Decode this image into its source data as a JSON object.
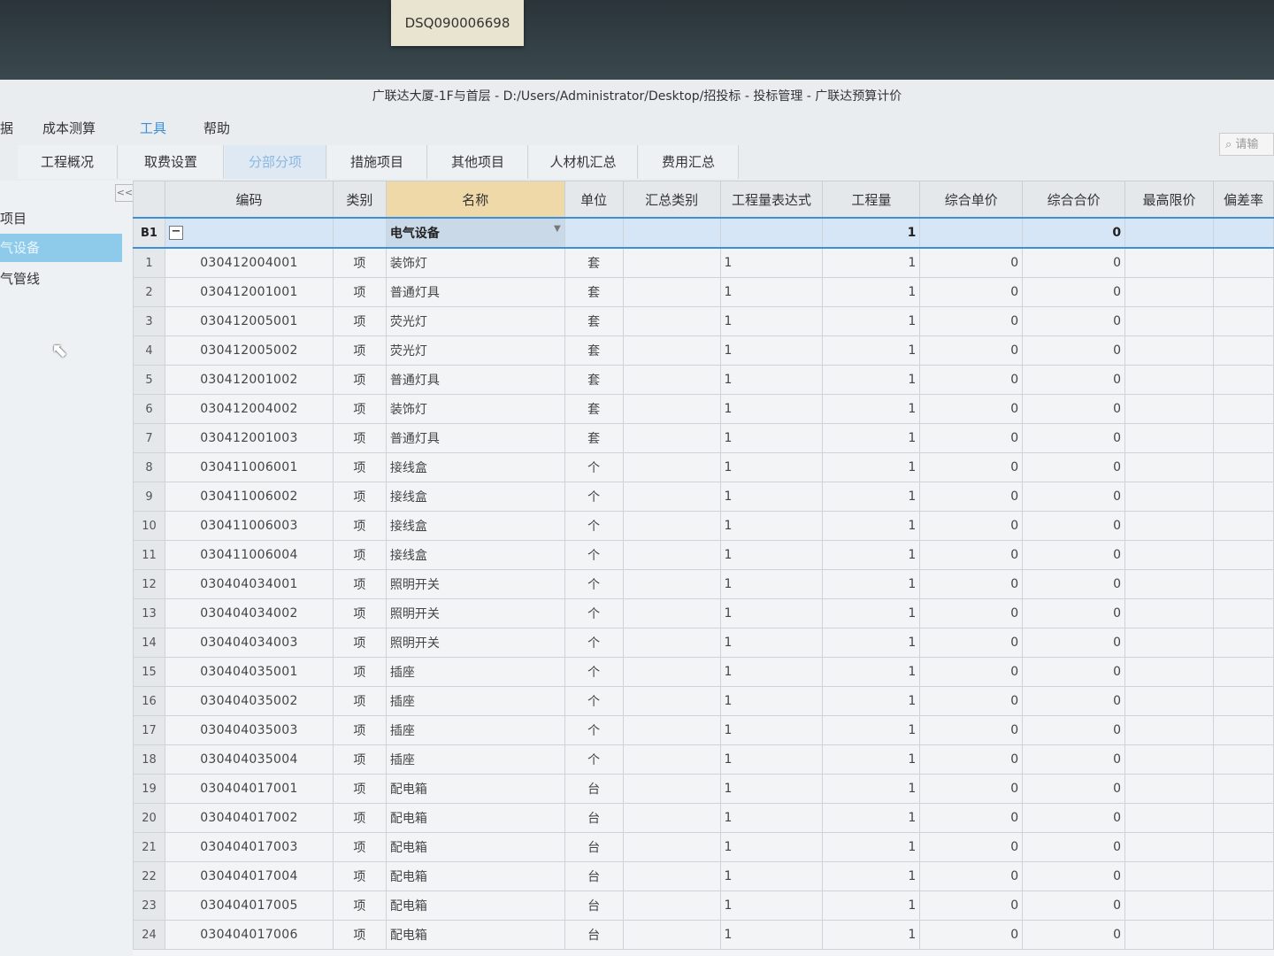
{
  "sticker": {
    "label": "DSQ090006698"
  },
  "window": {
    "title": "广联达大厦-1F与首层 - D:/Users/Administrator/Desktop/招投标 - 投标管理 - 广联达预算计价"
  },
  "menu": {
    "items": [
      {
        "label": "据"
      },
      {
        "label": "成本测算"
      },
      {
        "label": "工具"
      },
      {
        "label": "帮助"
      }
    ],
    "active_index": 2
  },
  "search": {
    "placeholder": "请输"
  },
  "tabs": {
    "items": [
      {
        "label": "工程概况"
      },
      {
        "label": "取费设置"
      },
      {
        "label": "分部分项"
      },
      {
        "label": "措施项目"
      },
      {
        "label": "其他项目"
      },
      {
        "label": "人材机汇总"
      },
      {
        "label": "费用汇总"
      }
    ],
    "active_index": 2
  },
  "sidebar": {
    "collapse_label": "<<",
    "items": [
      {
        "label": "项目"
      },
      {
        "label": "气设备"
      },
      {
        "label": "气管线"
      }
    ]
  },
  "table": {
    "headers": {
      "code": "编码",
      "type": "类别",
      "name": "名称",
      "unit": "单位",
      "summary": "汇总类别",
      "expr": "工程量表达式",
      "qty": "工程量",
      "unit_price": "综合单价",
      "total": "综合合价",
      "max_price": "最高限价",
      "dev": "偏差率"
    },
    "group": {
      "rn": "B1",
      "name": "电气设备",
      "qty": "1",
      "total": "0"
    },
    "rows": [
      {
        "rn": "1",
        "code": "030412004001",
        "type": "项",
        "name": "装饰灯",
        "unit": "套",
        "expr": "1",
        "qty": "1",
        "unit_price": "0",
        "total": "0"
      },
      {
        "rn": "2",
        "code": "030412001001",
        "type": "项",
        "name": "普通灯具",
        "unit": "套",
        "expr": "1",
        "qty": "1",
        "unit_price": "0",
        "total": "0"
      },
      {
        "rn": "3",
        "code": "030412005001",
        "type": "项",
        "name": "荧光灯",
        "unit": "套",
        "expr": "1",
        "qty": "1",
        "unit_price": "0",
        "total": "0"
      },
      {
        "rn": "4",
        "code": "030412005002",
        "type": "项",
        "name": "荧光灯",
        "unit": "套",
        "expr": "1",
        "qty": "1",
        "unit_price": "0",
        "total": "0"
      },
      {
        "rn": "5",
        "code": "030412001002",
        "type": "项",
        "name": "普通灯具",
        "unit": "套",
        "expr": "1",
        "qty": "1",
        "unit_price": "0",
        "total": "0"
      },
      {
        "rn": "6",
        "code": "030412004002",
        "type": "项",
        "name": "装饰灯",
        "unit": "套",
        "expr": "1",
        "qty": "1",
        "unit_price": "0",
        "total": "0"
      },
      {
        "rn": "7",
        "code": "030412001003",
        "type": "项",
        "name": "普通灯具",
        "unit": "套",
        "expr": "1",
        "qty": "1",
        "unit_price": "0",
        "total": "0"
      },
      {
        "rn": "8",
        "code": "030411006001",
        "type": "项",
        "name": "接线盒",
        "unit": "个",
        "expr": "1",
        "qty": "1",
        "unit_price": "0",
        "total": "0"
      },
      {
        "rn": "9",
        "code": "030411006002",
        "type": "项",
        "name": "接线盒",
        "unit": "个",
        "expr": "1",
        "qty": "1",
        "unit_price": "0",
        "total": "0"
      },
      {
        "rn": "10",
        "code": "030411006003",
        "type": "项",
        "name": "接线盒",
        "unit": "个",
        "expr": "1",
        "qty": "1",
        "unit_price": "0",
        "total": "0"
      },
      {
        "rn": "11",
        "code": "030411006004",
        "type": "项",
        "name": "接线盒",
        "unit": "个",
        "expr": "1",
        "qty": "1",
        "unit_price": "0",
        "total": "0"
      },
      {
        "rn": "12",
        "code": "030404034001",
        "type": "项",
        "name": "照明开关",
        "unit": "个",
        "expr": "1",
        "qty": "1",
        "unit_price": "0",
        "total": "0"
      },
      {
        "rn": "13",
        "code": "030404034002",
        "type": "项",
        "name": "照明开关",
        "unit": "个",
        "expr": "1",
        "qty": "1",
        "unit_price": "0",
        "total": "0"
      },
      {
        "rn": "14",
        "code": "030404034003",
        "type": "项",
        "name": "照明开关",
        "unit": "个",
        "expr": "1",
        "qty": "1",
        "unit_price": "0",
        "total": "0"
      },
      {
        "rn": "15",
        "code": "030404035001",
        "type": "项",
        "name": "插座",
        "unit": "个",
        "expr": "1",
        "qty": "1",
        "unit_price": "0",
        "total": "0"
      },
      {
        "rn": "16",
        "code": "030404035002",
        "type": "项",
        "name": "插座",
        "unit": "个",
        "expr": "1",
        "qty": "1",
        "unit_price": "0",
        "total": "0"
      },
      {
        "rn": "17",
        "code": "030404035003",
        "type": "项",
        "name": "插座",
        "unit": "个",
        "expr": "1",
        "qty": "1",
        "unit_price": "0",
        "total": "0"
      },
      {
        "rn": "18",
        "code": "030404035004",
        "type": "项",
        "name": "插座",
        "unit": "个",
        "expr": "1",
        "qty": "1",
        "unit_price": "0",
        "total": "0"
      },
      {
        "rn": "19",
        "code": "030404017001",
        "type": "项",
        "name": "配电箱",
        "unit": "台",
        "expr": "1",
        "qty": "1",
        "unit_price": "0",
        "total": "0"
      },
      {
        "rn": "20",
        "code": "030404017002",
        "type": "项",
        "name": "配电箱",
        "unit": "台",
        "expr": "1",
        "qty": "1",
        "unit_price": "0",
        "total": "0"
      },
      {
        "rn": "21",
        "code": "030404017003",
        "type": "项",
        "name": "配电箱",
        "unit": "台",
        "expr": "1",
        "qty": "1",
        "unit_price": "0",
        "total": "0"
      },
      {
        "rn": "22",
        "code": "030404017004",
        "type": "项",
        "name": "配电箱",
        "unit": "台",
        "expr": "1",
        "qty": "1",
        "unit_price": "0",
        "total": "0"
      },
      {
        "rn": "23",
        "code": "030404017005",
        "type": "项",
        "name": "配电箱",
        "unit": "台",
        "expr": "1",
        "qty": "1",
        "unit_price": "0",
        "total": "0"
      },
      {
        "rn": "24",
        "code": "030404017006",
        "type": "项",
        "name": "配电箱",
        "unit": "台",
        "expr": "1",
        "qty": "1",
        "unit_price": "0",
        "total": "0"
      }
    ]
  }
}
